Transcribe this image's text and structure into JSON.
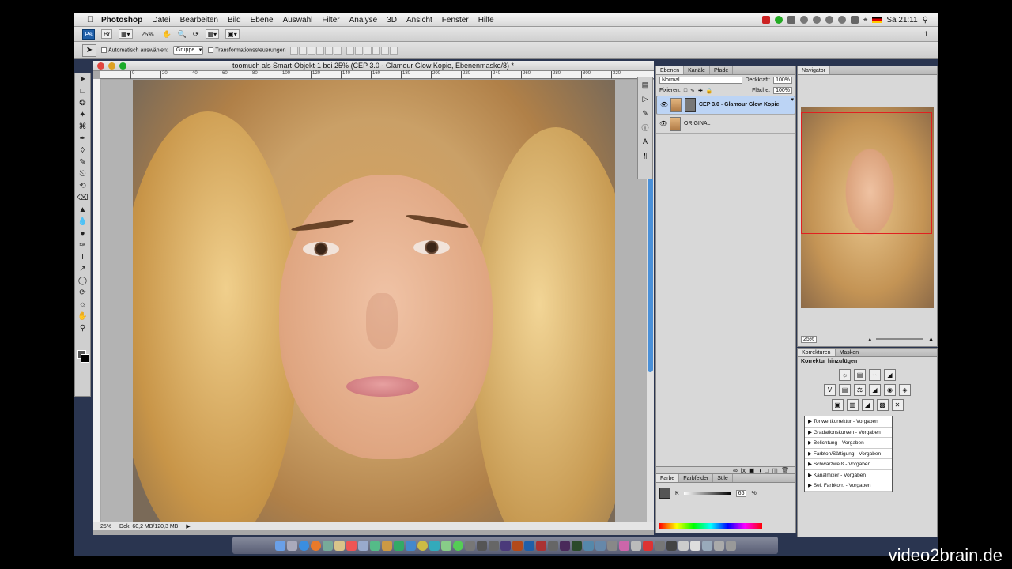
{
  "menubar": {
    "app": "Photoshop",
    "items": [
      "Datei",
      "Bearbeiten",
      "Bild",
      "Ebene",
      "Auswahl",
      "Filter",
      "Analyse",
      "3D",
      "Ansicht",
      "Fenster",
      "Hilfe"
    ],
    "clock": "Sa 21:11"
  },
  "appbar": {
    "logo": "Ps",
    "zoom": "25%",
    "workspace": "1"
  },
  "options": {
    "auto_select_label": "Automatisch auswählen:",
    "auto_select_value": "Gruppe",
    "transform_label": "Transformationssteuerungen"
  },
  "document": {
    "title": "toomuch als Smart-Objekt-1 bei 25% (CEP 3.0 - Glamour Glow Kopie, Ebenenmaske/8) *",
    "ruler_ticks": [
      "0",
      "20",
      "40",
      "60",
      "80",
      "100",
      "120",
      "140",
      "160",
      "180",
      "200",
      "220",
      "240",
      "260",
      "280",
      "300",
      "320"
    ],
    "status_zoom": "25%",
    "status_doc": "Dok: 60,2 MB/120,3 MB"
  },
  "layers_panel": {
    "tabs": [
      "Ebenen",
      "Kanäle",
      "Pfade"
    ],
    "blend_mode": "Normal",
    "opacity_label": "Deckkraft:",
    "opacity_value": "100%",
    "lock_label": "Fixieren:",
    "fill_label": "Fläche:",
    "fill_value": "100%",
    "layers": [
      {
        "name": "CEP 3.0 - Glamour Glow Kopie",
        "selected": true
      },
      {
        "name": "ORIGINAL",
        "selected": false
      }
    ]
  },
  "color_panel": {
    "tabs": [
      "Farbe",
      "Farbfelder",
      "Stile"
    ],
    "k_label": "K",
    "k_value": "66",
    "unit": "%"
  },
  "navigator": {
    "title": "Navigator",
    "zoom": "25%"
  },
  "korrekturen": {
    "tabs": [
      "Korrekturen",
      "Masken"
    ],
    "heading": "Korrektur hinzufügen",
    "presets": [
      "Tonwertkorrektur - Vorgaben",
      "Gradationskurven - Vorgaben",
      "Belichtung - Vorgaben",
      "Farbton/Sättigung - Vorgaben",
      "Schwarzweiß - Vorgaben",
      "Kanalmixer - Vorgaben",
      "Sel. Farbkorr. - Vorgaben"
    ]
  },
  "watermark": "video2brain.de",
  "colors": {
    "selection": "#bcd4f5",
    "scroll_accent": "#4a90d8",
    "nav_frame": "#e02020"
  }
}
